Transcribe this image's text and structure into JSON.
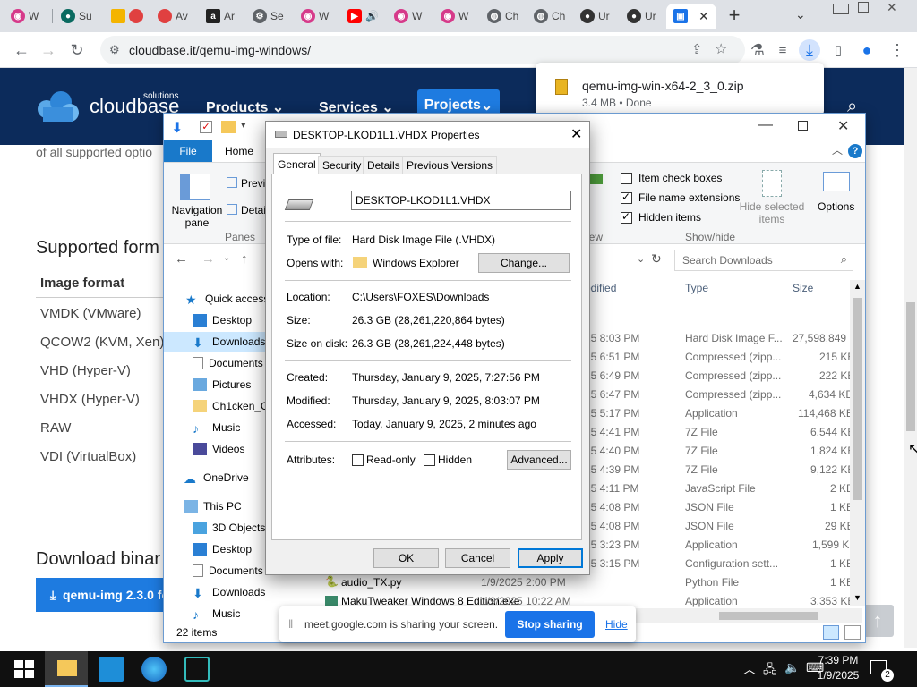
{
  "browser": {
    "tabs": [
      {
        "label": "W",
        "color": "#d63a8a"
      },
      {
        "label": "Su",
        "color": "#0a6a60"
      },
      {
        "label": "",
        "color": "#f4b400"
      },
      {
        "label": "Av",
        "color": "#e04040"
      },
      {
        "label": "Ar",
        "color": "#222"
      },
      {
        "label": "Se",
        "color": "#5f6368"
      },
      {
        "label": "W",
        "color": "#d63a8a"
      },
      {
        "label": "",
        "color": "#ff0000"
      },
      {
        "label": "W",
        "color": "#d63a8a"
      },
      {
        "label": "W",
        "color": "#d63a8a"
      },
      {
        "label": "Ch",
        "color": "#5f6368"
      },
      {
        "label": "Ch",
        "color": "#5f6368"
      },
      {
        "label": "Ur",
        "color": "#333"
      },
      {
        "label": "Ur",
        "color": "#333"
      }
    ],
    "url": "cloudbase.it/qemu-img-windows/"
  },
  "download": {
    "filename": "qemu-img-win-x64-2_3_0.zip",
    "status": "3.4 MB • Done"
  },
  "site": {
    "brand": "cloudbase",
    "brand_sup": "solutions",
    "nav": {
      "products": "Products",
      "services": "Services",
      "projects": "Projects"
    },
    "partial_text": "of all supported optio",
    "supported_heading": "Supported form",
    "col_header": "Image format",
    "formats": [
      "VMDK (VMware)",
      "QCOW2 (KVM, Xen)",
      "VHD (Hyper-V)",
      "VHDX (Hyper-V)",
      "RAW",
      "VDI (VirtualBox)"
    ],
    "download_heading": "Download binar",
    "download_btn": "qemu-img 2.3.0 fo"
  },
  "explorer": {
    "ribbon_tabs": {
      "file": "File",
      "home": "Home"
    },
    "ribbon": {
      "nav_pane": "Navigation pane",
      "preview": "Previ",
      "details": "Detai",
      "panes": "Panes",
      "view_group": "iew",
      "item_check_boxes": "Item check boxes",
      "file_name_extensions": "File name extensions",
      "hidden_items": "Hidden items",
      "hide_selected": "Hide selected items",
      "show_hide": "Show/hide",
      "options": "Options"
    },
    "search_placeholder": "Search Downloads",
    "columns": {
      "modified": "odified",
      "type": "Type",
      "size": "Size"
    },
    "nav": [
      "Quick access",
      "Desktop",
      "Downloads",
      "Documents",
      "Pictures",
      "Ch1cken_Gu",
      "Music",
      "Videos",
      "OneDrive",
      "This PC",
      "3D Objects",
      "Desktop",
      "Documents",
      "Downloads",
      "Music"
    ],
    "files": [
      {
        "name": "",
        "date": "25 8:03 PM",
        "type": "Hard Disk Image F...",
        "size": "27,598,849 ..."
      },
      {
        "name": "",
        "date": "25 6:51 PM",
        "type": "Compressed (zipp...",
        "size": "215 KB"
      },
      {
        "name": "",
        "date": "25 6:49 PM",
        "type": "Compressed (zipp...",
        "size": "222 KB"
      },
      {
        "name": "",
        "date": "25 6:47 PM",
        "type": "Compressed (zipp...",
        "size": "4,634 KB"
      },
      {
        "name": "",
        "date": "25 5:17 PM",
        "type": "Application",
        "size": "114,468 KB"
      },
      {
        "name": "",
        "date": "25 4:41 PM",
        "type": "7Z File",
        "size": "6,544 KB"
      },
      {
        "name": "",
        "date": "25 4:40 PM",
        "type": "7Z File",
        "size": "1,824 KB"
      },
      {
        "name": "",
        "date": "25 4:39 PM",
        "type": "7Z File",
        "size": "9,122 KB"
      },
      {
        "name": "",
        "date": "25 4:11 PM",
        "type": "JavaScript File",
        "size": "2 KB"
      },
      {
        "name": "",
        "date": "25 4:08 PM",
        "type": "JSON File",
        "size": "1 KB"
      },
      {
        "name": "",
        "date": "25 4:08 PM",
        "type": "JSON File",
        "size": "29 KB"
      },
      {
        "name": "",
        "date": "25 3:23 PM",
        "type": "Application",
        "size": "1,599 KB"
      },
      {
        "name": "",
        "date": "25 3:15 PM",
        "type": "Configuration sett...",
        "size": "1 KB"
      },
      {
        "name": "audio_TX.py",
        "date": "1/9/2025 2:00 PM",
        "type": "Python File",
        "size": "1 KB"
      },
      {
        "name": "MakuTweaker Windows 8 Edition.exe",
        "date": "1/9/2025 10:22 AM",
        "type": "Application",
        "size": "3,353 KB"
      }
    ],
    "status": "22 items"
  },
  "props": {
    "title": "DESKTOP-LKOD1L1.VHDX Properties",
    "tabs": [
      "General",
      "Security",
      "Details",
      "Previous Versions"
    ],
    "filename": "DESKTOP-LKOD1L1.VHDX",
    "type_label": "Type of file:",
    "type_value": "Hard Disk Image File (.VHDX)",
    "opens_label": "Opens with:",
    "opens_value": "Windows Explorer",
    "change_btn": "Change...",
    "location_label": "Location:",
    "location_value": "C:\\Users\\FOXES\\Downloads",
    "size_label": "Size:",
    "size_value": "26.3 GB (28,261,220,864 bytes)",
    "sod_label": "Size on disk:",
    "sod_value": "26.3 GB (28,261,224,448 bytes)",
    "created_label": "Created:",
    "created_value": "Thursday, January 9, 2025, 7:27:56 PM",
    "modified_label": "Modified:",
    "modified_value": "Thursday, January 9, 2025, 8:03:07 PM",
    "accessed_label": "Accessed:",
    "accessed_value": "Today, January 9, 2025, 2 minutes ago",
    "attr_label": "Attributes:",
    "readonly": "Read-only",
    "hidden": "Hidden",
    "advanced_btn": "Advanced...",
    "ok": "OK",
    "cancel": "Cancel",
    "apply": "Apply"
  },
  "sharebar": {
    "text": "meet.google.com is sharing your screen.",
    "stop": "Stop sharing",
    "hide": "Hide"
  },
  "taskbar": {
    "time": "7:39 PM",
    "date": "1/9/2025",
    "notif_count": "2"
  }
}
